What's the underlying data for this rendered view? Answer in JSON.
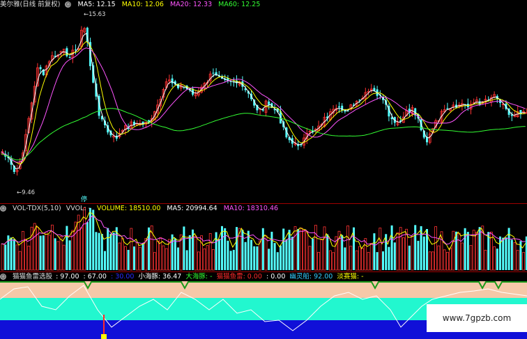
{
  "price_panel": {
    "title": "美尔雅(日线 前复权)",
    "ma_items": [
      {
        "label": "MA5: 12.15",
        "color": "#ffffff"
      },
      {
        "label": "MA10: 12.06",
        "color": "#ffff00"
      },
      {
        "label": "MA20: 12.33",
        "color": "#ff55ff"
      },
      {
        "label": "MA60: 12.25",
        "color": "#33ff33"
      }
    ],
    "high_label": "15.63",
    "low_label": "9.46"
  },
  "volume_panel": {
    "label_name": "VOL-TDX(5,10)",
    "label_vvol": "VVOL: -",
    "label_volume": "VOLUME: 18510.00",
    "label_ma5": "MA5: 20994.64",
    "label_ma10": "MA10: 18310.46",
    "marker": "停"
  },
  "indicator_panel": {
    "name": "猫猫鱼雷选股",
    "values": [
      {
        "label": ": 97.00",
        "color": "#ffffff"
      },
      {
        "label": ": 67.00",
        "color": "#ffffff"
      },
      {
        "label": ": 30.00",
        "color": "#2b2bff"
      },
      {
        "label": "小海豚: 36.47",
        "color": "#ffffff"
      },
      {
        "label": "大海豚: -",
        "color": "#33ff33"
      },
      {
        "label": "猫猫鱼雷: 0.00",
        "color": "#ff2a2a"
      },
      {
        "label": ": 0.00",
        "color": "#ffffff"
      },
      {
        "label": "幽灵船: 92.00",
        "color": "#33ccff"
      },
      {
        "label": "淡赛猫: -",
        "color": "#ffff00"
      }
    ]
  },
  "watermark": "www.7gpzb.com",
  "colors": {
    "up": "#ff3333",
    "down": "#54ffff",
    "ma5": "#ffffff",
    "ma10": "#ffff00",
    "ma20": "#ff55ff",
    "ma60": "#33ff33",
    "band_top": "#f5c8a8",
    "band_mid": "#22f7cf",
    "band_bot": "#1010d8"
  }
}
